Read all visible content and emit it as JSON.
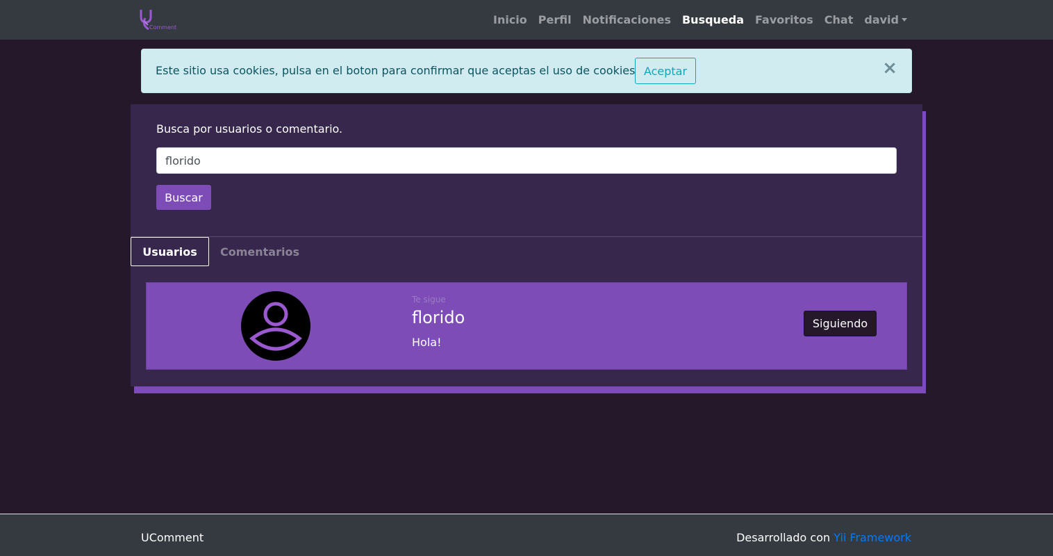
{
  "navbar": {
    "logo_text": "Comment",
    "items": [
      {
        "label": "Inicio"
      },
      {
        "label": "Perfil"
      },
      {
        "label": "Notificaciones"
      },
      {
        "label": "Busqueda"
      },
      {
        "label": "Favoritos"
      },
      {
        "label": "Chat"
      }
    ],
    "user_menu_label": "david"
  },
  "cookie_alert": {
    "message": "Este sitio usa cookies, pulsa en el boton para confirmar que aceptas el uso de cookies",
    "accept_label": "Aceptar",
    "close_symbol": "×"
  },
  "search": {
    "label": "Busca por usuarios o comentario.",
    "value": "florido",
    "button_label": "Buscar"
  },
  "tabs": [
    {
      "label": "Usuarios"
    },
    {
      "label": "Comentarios"
    }
  ],
  "results": [
    {
      "status": "Te sigue",
      "username": "florido",
      "bio": "Hola!",
      "follow_label": "Siguiendo"
    }
  ],
  "footer": {
    "brand": "UComment",
    "credit_prefix": "Desarrollado con",
    "credit_link": "Yii Framework"
  },
  "colors": {
    "navbar_bg": "#343a40",
    "page_bg": "#24182a",
    "card_bg": "#37274d",
    "accent_purple": "#7d4cb6",
    "alert_bg": "#d1ecf1",
    "link_blue": "#007bff"
  }
}
